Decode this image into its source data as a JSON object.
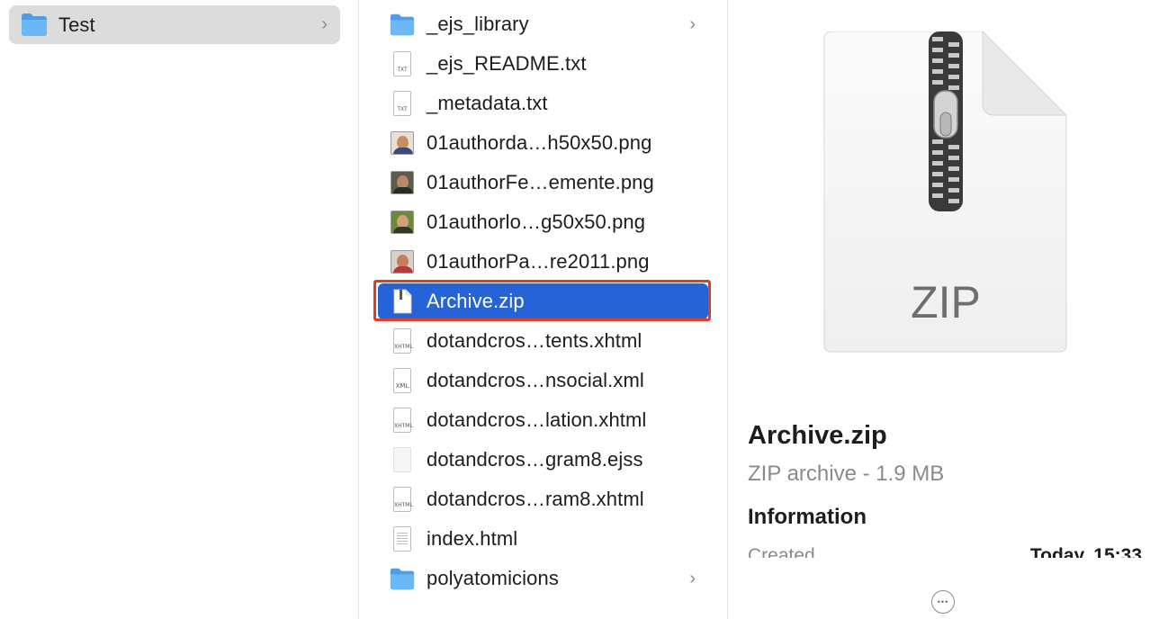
{
  "column1": {
    "items": [
      {
        "label": "Test",
        "icon": "folder-icon"
      }
    ]
  },
  "column2": {
    "items": [
      {
        "label": "_ejs_library",
        "icon": "folder-icon",
        "chevron": true
      },
      {
        "label": "_ejs_README.txt",
        "icon": "txt-file-icon",
        "tag": "TXT"
      },
      {
        "label": "_metadata.txt",
        "icon": "txt-file-icon",
        "tag": "TXT"
      },
      {
        "label": "01authorda…h50x50.png",
        "icon": "png-thumbnail-icon"
      },
      {
        "label": "01authorFe…emente.png",
        "icon": "png-thumbnail-icon"
      },
      {
        "label": "01authorlo…g50x50.png",
        "icon": "png-thumbnail-icon"
      },
      {
        "label": "01authorPa…re2011.png",
        "icon": "png-thumbnail-icon"
      },
      {
        "label": "Archive.zip",
        "icon": "zip-file-icon",
        "selected": true
      },
      {
        "label": "dotandcros…tents.xhtml",
        "icon": "xhtml-file-icon",
        "tag": "XHTML"
      },
      {
        "label": "dotandcros…nsocial.xml",
        "icon": "xml-file-icon",
        "tag": "XML"
      },
      {
        "label": "dotandcros…lation.xhtml",
        "icon": "xhtml-file-icon",
        "tag": "XHTML"
      },
      {
        "label": "dotandcros…gram8.ejss",
        "icon": "blank-file-icon"
      },
      {
        "label": "dotandcros…ram8.xhtml",
        "icon": "xhtml-file-icon",
        "tag": "XHTML"
      },
      {
        "label": "index.html",
        "icon": "html-file-icon"
      },
      {
        "label": "polyatomicions",
        "icon": "folder-icon",
        "chevron": true
      }
    ]
  },
  "preview": {
    "icon_label": "ZIP",
    "title": "Archive.zip",
    "subtitle": "ZIP archive - 1.9 MB",
    "section": "Information",
    "created_label": "Created",
    "created_value": "Today, 15:33",
    "more_label": "•••"
  },
  "colors": {
    "selection": "#2563d6",
    "focus_ring": "#e23c25",
    "folder": "#5aaef0"
  }
}
